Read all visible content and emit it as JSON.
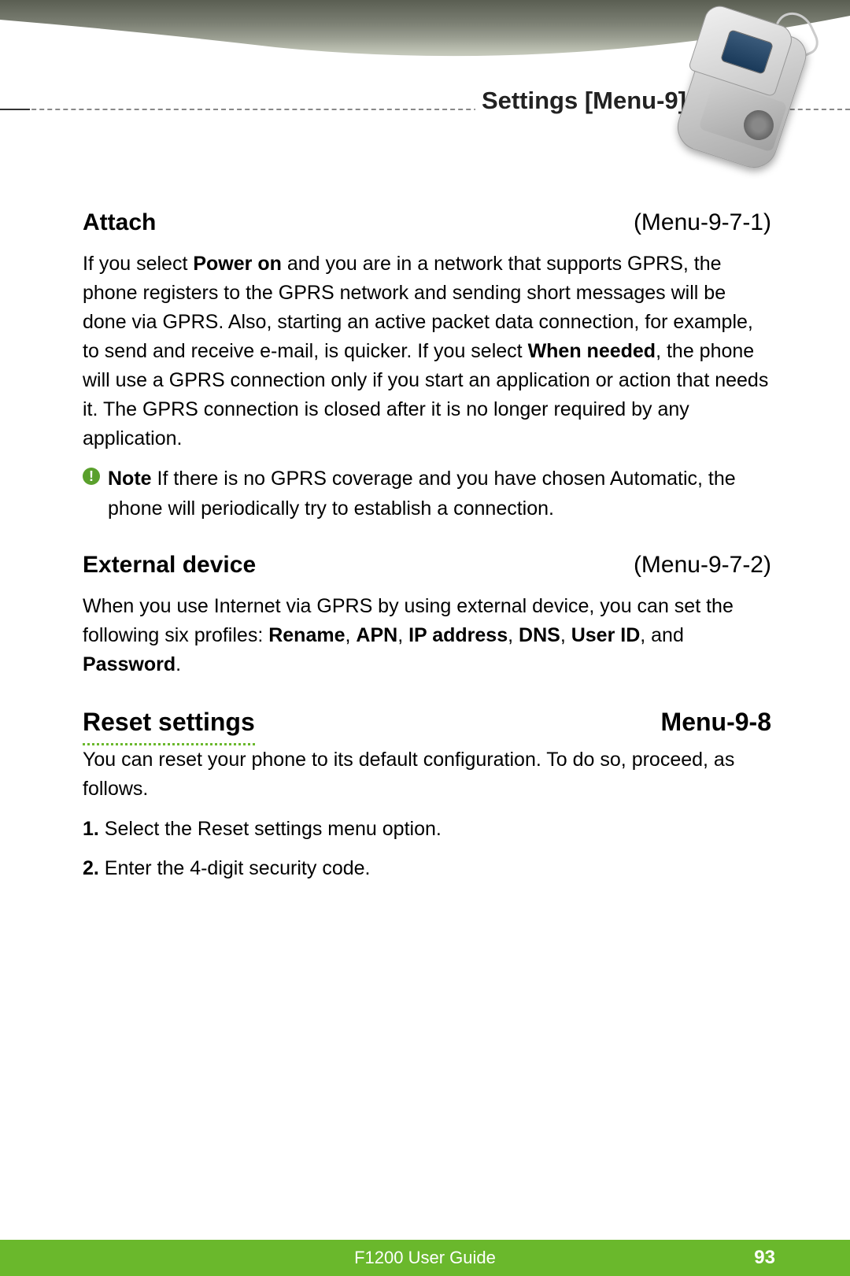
{
  "header": {
    "title": "Settings [Menu-9]"
  },
  "sections": {
    "attach": {
      "title": "Attach",
      "menu": "(Menu-9-7-1)",
      "body_p1": "If you select ",
      "body_b1": "Power on",
      "body_p2": " and you are in a network that supports GPRS, the phone registers to the GPRS network and sending short messages will be done via GPRS. Also, starting an active packet data connection, for example, to send and receive e-mail, is quicker. If you select ",
      "body_b2": "When needed",
      "body_p3": ", the phone will use a GPRS connection only if you start an application or action that needs it. The GPRS connection is closed after it is no longer required by any application.",
      "note_label": "Note",
      "note_text": "  If there is no GPRS coverage and you have chosen Automatic, the phone will periodically try to establish a connection."
    },
    "external": {
      "title": "External device",
      "menu": "(Menu-9-7-2)",
      "body_p1": "When you use Internet via GPRS by using external device, you can set the following six profiles: ",
      "profiles": {
        "p1": "Rename",
        "p2": "APN",
        "p3": "IP address",
        "p4": "DNS",
        "p5": "User ID",
        "p6": "Password"
      },
      "body_and": ", and "
    },
    "reset": {
      "title": "Reset settings",
      "menu": "Menu-9-8",
      "body": "You can reset your phone to its default configuration. To do so, proceed, as follows.",
      "step1_num": "1.",
      "step1": " Select the Reset settings menu option.",
      "step2_num": "2.",
      "step2": " Enter the 4-digit security code."
    }
  },
  "footer": {
    "guide": "F1200 User Guide",
    "page": "93"
  }
}
